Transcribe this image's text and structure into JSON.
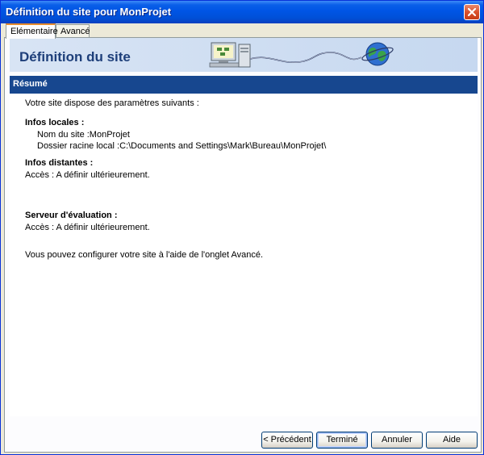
{
  "window": {
    "title": "Définition du site pour MonProjet"
  },
  "tabs": [
    {
      "label": "Elémentaire",
      "active": true
    },
    {
      "label": "Avancé",
      "active": false
    }
  ],
  "banner": {
    "title": "Définition du site"
  },
  "section": {
    "title": "Résumé"
  },
  "summary": {
    "intro": "Votre site dispose des paramètres suivants :",
    "local_heading": "Infos locales :",
    "site_name": "Nom du site :MonProjet",
    "root_folder": "Dossier racine local :C:\\Documents and Settings\\Mark\\Bureau\\MonProjet\\",
    "remote_heading": "Infos distantes :",
    "remote_access": "Accès : A définir ultérieurement.",
    "testing_heading": "Serveur d'évaluation :",
    "testing_access": "Accès : A définir ultérieurement.",
    "footer_note": "Vous pouvez configurer votre site à l'aide de l'onglet Avancé."
  },
  "buttons": {
    "previous": "< Précédent",
    "finish": "Terminé",
    "cancel": "Annuler",
    "help": "Aide"
  },
  "colors": {
    "title_bar": "#0055e5",
    "section_bar": "#17478f",
    "banner_text": "#1e3f7a"
  },
  "icons": {
    "close": "close-icon",
    "banner_art": "computer-globe-icon"
  }
}
